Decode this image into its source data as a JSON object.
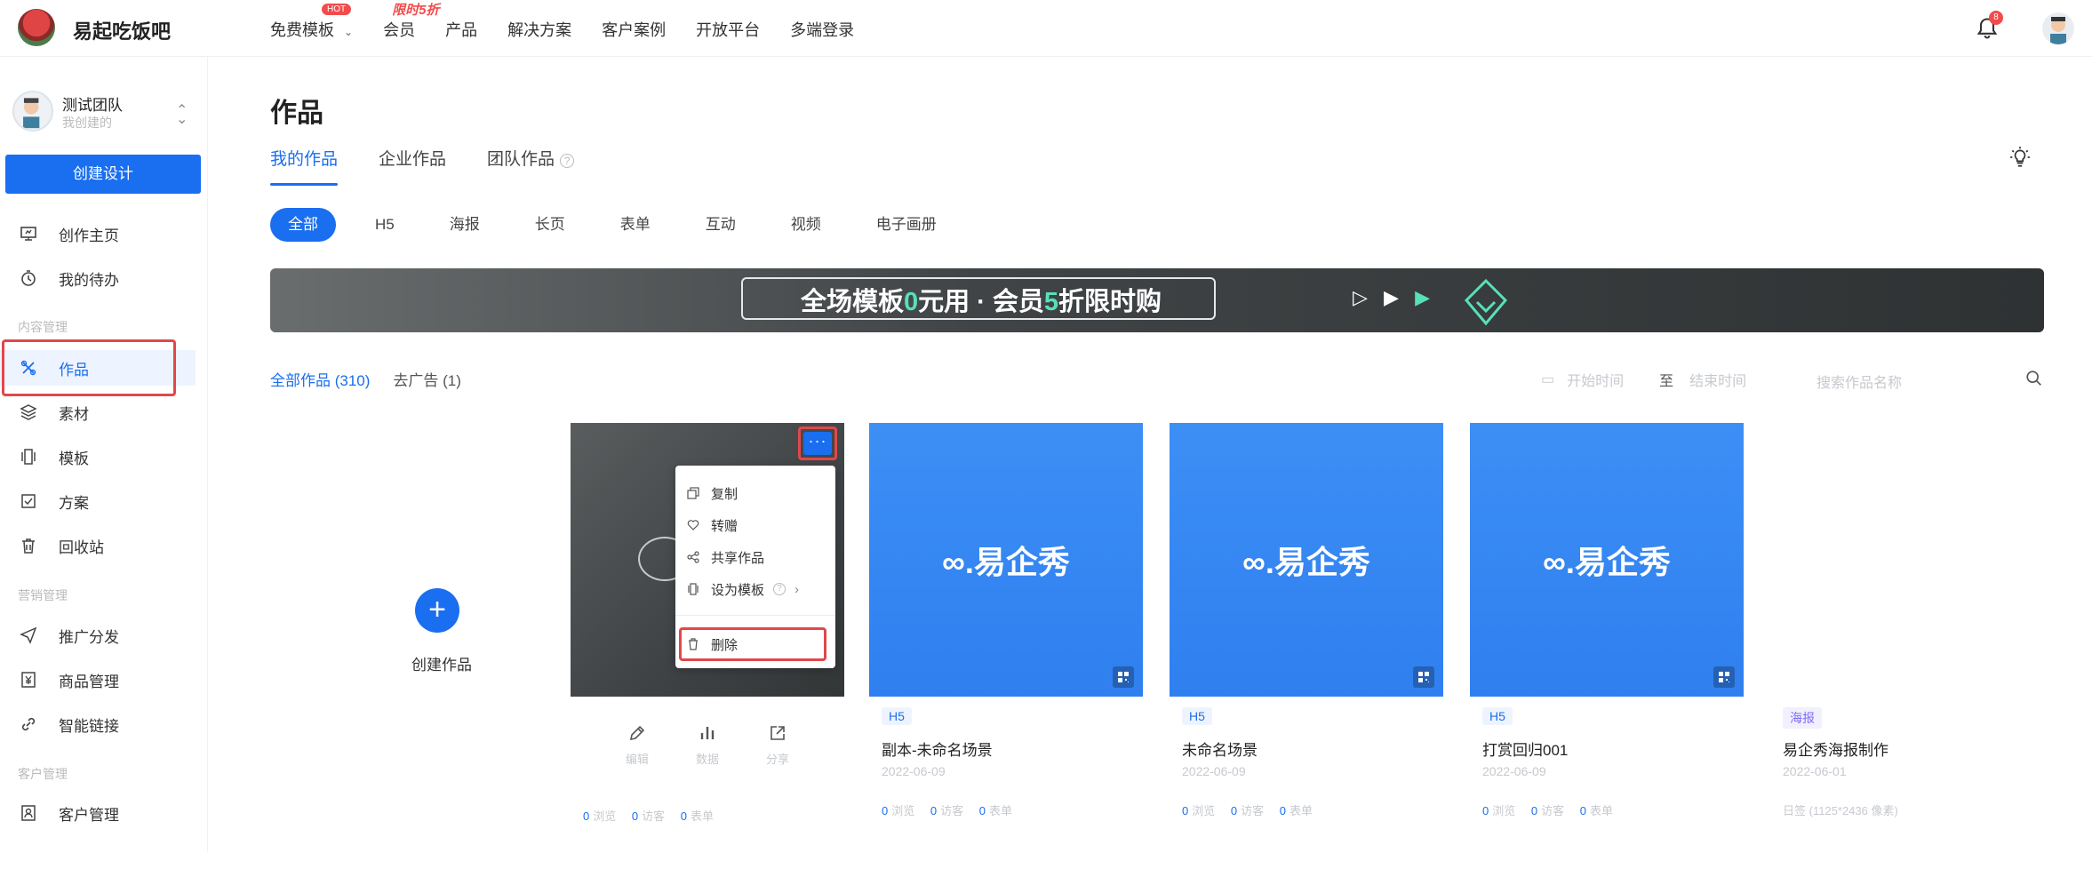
{
  "app": {
    "brand": "易起吃饭吧"
  },
  "topnav": {
    "items": [
      {
        "label": "免费模板",
        "hot": "HOT"
      },
      {
        "label": "会员",
        "promo": "限时5折"
      },
      {
        "label": "产品"
      },
      {
        "label": "解决方案"
      },
      {
        "label": "客户案例"
      },
      {
        "label": "开放平台"
      },
      {
        "label": "多端登录"
      }
    ],
    "notification_count": "8"
  },
  "sidebar": {
    "team_name": "测试团队",
    "team_sub": "我创建的",
    "create_label": "创建设计",
    "items": [
      {
        "label": "创作主页",
        "icon": "monitor-icon"
      },
      {
        "label": "我的待办",
        "icon": "clock-icon"
      }
    ],
    "section_content": "内容管理",
    "content_items": [
      {
        "label": "作品",
        "icon": "tools-icon"
      },
      {
        "label": "素材",
        "icon": "layers-icon"
      },
      {
        "label": "模板",
        "icon": "template-icon"
      },
      {
        "label": "方案",
        "icon": "checklist-icon"
      },
      {
        "label": "回收站",
        "icon": "trash-icon"
      }
    ],
    "section_marketing": "营销管理",
    "marketing_items": [
      {
        "label": "推广分发",
        "icon": "send-icon"
      },
      {
        "label": "商品管理",
        "icon": "yen-icon"
      },
      {
        "label": "智能链接",
        "icon": "link-icon"
      }
    ],
    "section_customer": "客户管理",
    "customer_items": [
      {
        "label": "客户管理",
        "icon": "contact-icon"
      }
    ]
  },
  "main": {
    "title": "作品",
    "tabs": [
      "我的作品",
      "企业作品",
      "团队作品"
    ],
    "filters": [
      "全部",
      "H5",
      "海报",
      "长页",
      "表单",
      "互动",
      "视频",
      "电子画册"
    ],
    "banner": {
      "pre": "全场模板",
      "g1": "0",
      "mid": "元用 · 会员",
      "g2": "5",
      "post": "折限时购",
      "arrows": "▷ ▶",
      "arrow_g": "▶"
    },
    "works_all": "全部作品 (310)",
    "works_ads": "去广告 (1)",
    "date_start": "开始时间",
    "date_to": "至",
    "date_end": "结束时间",
    "search_placeholder": "搜索作品名称",
    "create_work": "创建作品",
    "dropdown": [
      "复制",
      "转赠",
      "共享作品",
      "设为模板",
      "删除"
    ],
    "actions": [
      "编辑",
      "数据",
      "分享"
    ],
    "stat_labels": {
      "views": "浏览",
      "visitors": "访客",
      "forms": "表单"
    },
    "cards": [
      {
        "tag": "",
        "title": "",
        "date": "",
        "stats": [
          "0",
          "0",
          "0"
        ]
      },
      {
        "tag": "H5",
        "title": "副本-未命名场景",
        "date": "2022-06-09",
        "logo": "∞.易企秀",
        "stats": [
          "0",
          "0",
          "0"
        ]
      },
      {
        "tag": "H5",
        "title": "未命名场景",
        "date": "2022-06-09",
        "logo": "∞.易企秀",
        "stats": [
          "0",
          "0",
          "0"
        ]
      },
      {
        "tag": "H5",
        "title": "打赏回归001",
        "date": "2022-06-09",
        "logo": "∞.易企秀",
        "stats": [
          "0",
          "0",
          "0"
        ]
      },
      {
        "tag": "海报",
        "title": "易企秀海报制作",
        "date": "2022-06-01",
        "size": "日签 (1125*2436 像素)"
      }
    ]
  },
  "colors": {
    "primary": "#1a6ef0",
    "danger": "#e0484b",
    "accent": "#58e0b8"
  }
}
